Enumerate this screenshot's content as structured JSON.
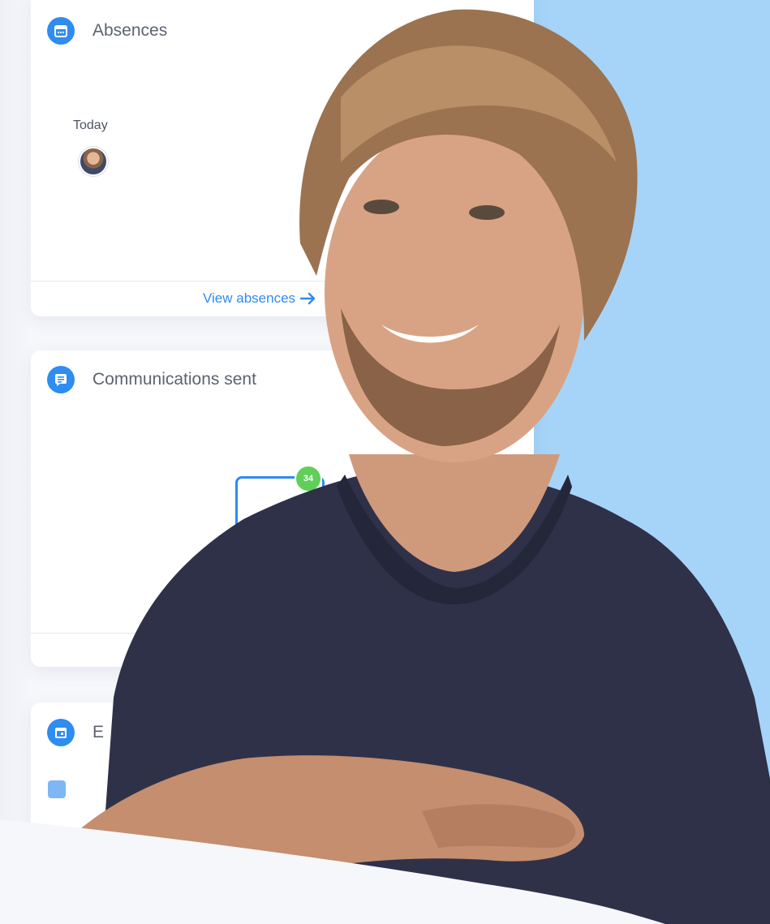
{
  "cards": {
    "absences": {
      "title": "Absences",
      "icon": "calendar-icon",
      "today_label": "Today",
      "view_link": "View absences"
    },
    "communications": {
      "title": "Communications sent",
      "icon": "message-icon",
      "badge_count": "34"
    },
    "events": {
      "title_fragment": "E",
      "icon": "event-icon"
    }
  },
  "colors": {
    "accent": "#2f8cf0",
    "badge": "#5fcf5a",
    "side_panel": "#a6d4f9",
    "page_background": "#f6f7fb"
  }
}
